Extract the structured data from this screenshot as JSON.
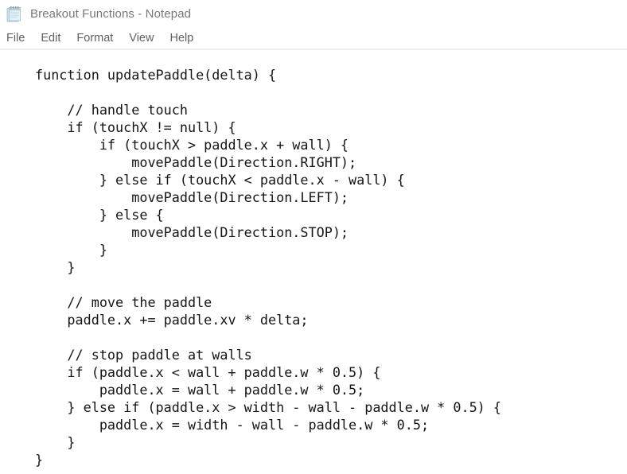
{
  "window": {
    "title": "Breakout Functions - Notepad",
    "icon": "notepad-icon",
    "background_color": "#ffffff",
    "title_color": "#77787a"
  },
  "menubar": {
    "items": [
      {
        "label": "File"
      },
      {
        "label": "Edit"
      },
      {
        "label": "Format"
      },
      {
        "label": "View"
      },
      {
        "label": "Help"
      }
    ],
    "separator_color": "#eeeff1",
    "text_color": "#5d6266"
  },
  "editor": {
    "text_color": "#151515",
    "content": "function updatePaddle(delta) {\n\n    // handle touch\n    if (touchX != null) {\n        if (touchX > paddle.x + wall) {\n            movePaddle(Direction.RIGHT);\n        } else if (touchX < paddle.x - wall) {\n            movePaddle(Direction.LEFT);\n        } else {\n            movePaddle(Direction.STOP);\n        }\n    }\n\n    // move the paddle\n    paddle.x += paddle.xv * delta;\n\n    // stop paddle at walls\n    if (paddle.x < wall + paddle.w * 0.5) {\n        paddle.x = wall + paddle.w * 0.5;\n    } else if (paddle.x > width - wall - paddle.w * 0.5) {\n        paddle.x = width - wall - paddle.w * 0.5;\n    }\n}"
  }
}
